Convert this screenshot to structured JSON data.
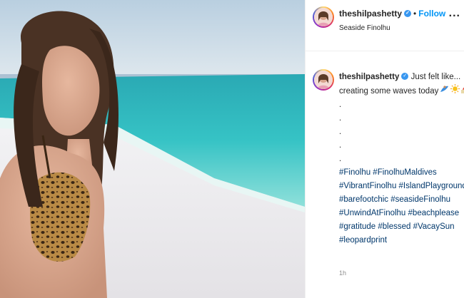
{
  "post": {
    "username": "theshilpashetty",
    "follow_label": "Follow",
    "separator": "•",
    "location": "Seaside Finolhu",
    "more_label": "...",
    "caption": {
      "line1": "Just felt like...",
      "line2": "creating some waves today",
      "dots": [
        ".",
        ".",
        ".",
        ".",
        "."
      ],
      "hashtags": [
        "#Finolhu #FinolhuMaldives",
        "#VibrantFinolhu #IslandPlayground",
        "#barefootchic #seasideFinolhu",
        "#UnwindAtFinolhu #beachplease",
        "#gratitude #blessed #VacaySun",
        "#leopardprint"
      ]
    },
    "time_ago": "1h"
  },
  "colors": {
    "link": "#00376b",
    "follow": "#0095f6",
    "verified": "#3897f0",
    "timestamp": "#8e8e8e"
  },
  "icons": [
    "verified-badge-icon",
    "more-options-icon",
    "surfer-emoji",
    "sun-emoji",
    "beach-emoji"
  ]
}
